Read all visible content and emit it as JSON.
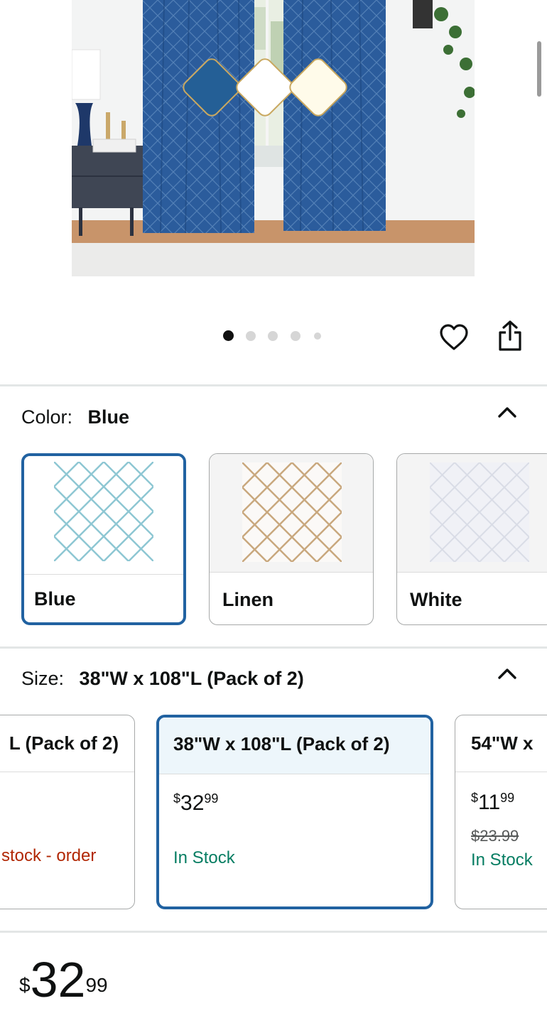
{
  "gallery": {
    "swatch_colors": [
      "#245f96",
      "#ffffff",
      "#fffbea"
    ],
    "dot_count": 5,
    "active_dot": 1
  },
  "actions": {
    "favorite_icon": "heart-icon",
    "share_icon": "share-icon"
  },
  "color_section": {
    "label": "Color:",
    "selected": "Blue",
    "options": [
      {
        "name": "Blue",
        "pattern_color": "#8ec7d3",
        "bg": "#ffffff"
      },
      {
        "name": "Linen",
        "pattern_color": "#c9a87e",
        "bg": "#fbf9f7"
      },
      {
        "name": "White",
        "pattern_color": "#d9dce6",
        "bg": "#f0f1f6"
      }
    ]
  },
  "size_section": {
    "label": "Size:",
    "selected": "38\"W x 108\"L (Pack of 2)",
    "options": [
      {
        "title": "L (Pack of 2)",
        "stock": "stock - order"
      },
      {
        "title": "38\"W x 108\"L (Pack of 2)",
        "price_dollars": "32",
        "price_cents": "99",
        "currency": "$",
        "stock": "In Stock"
      },
      {
        "title": "54\"W x",
        "price_dollars": "11",
        "price_cents": "99",
        "currency": "$",
        "list_price": "$23.99",
        "stock": "In Stock"
      }
    ]
  },
  "price": {
    "currency": "$",
    "dollars": "32",
    "cents": "99"
  }
}
